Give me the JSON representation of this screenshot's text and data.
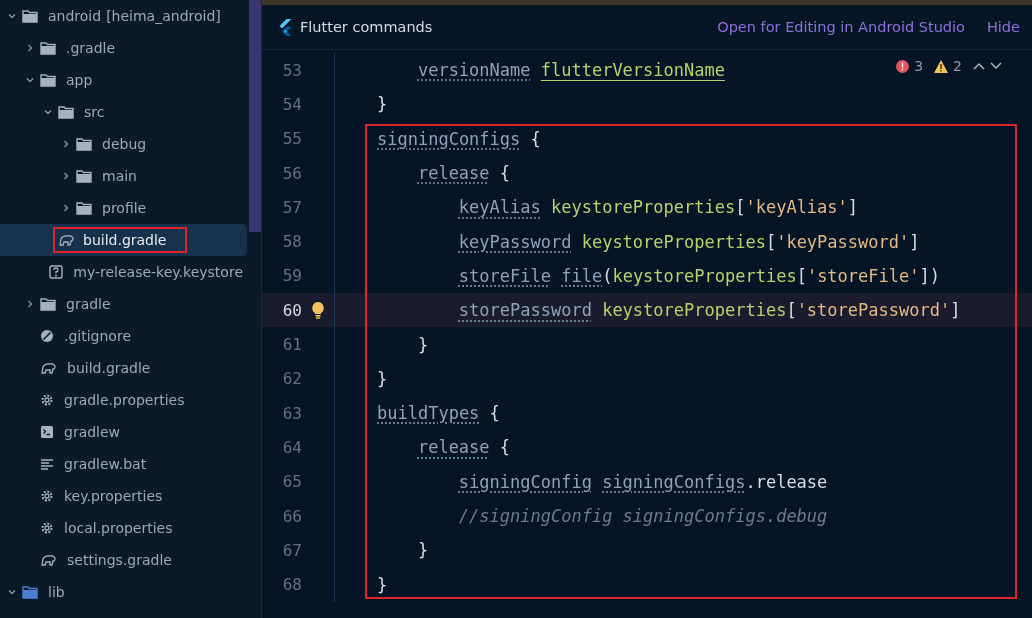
{
  "project_tree": [
    {
      "label": "android",
      "suffix": "[heima_android]",
      "kind": "folder",
      "expanded": true,
      "selected": false,
      "children": [
        {
          "label": ".gradle",
          "kind": "folder",
          "expanded": false,
          "selected": false
        },
        {
          "label": "app",
          "kind": "folder",
          "expanded": true,
          "selected": false,
          "children": [
            {
              "label": "src",
              "kind": "folder",
              "expanded": true,
              "selected": false,
              "children": [
                {
                  "label": "debug",
                  "kind": "folder",
                  "expanded": false,
                  "selected": false
                },
                {
                  "label": "main",
                  "kind": "folder",
                  "expanded": false,
                  "selected": false
                },
                {
                  "label": "profile",
                  "kind": "folder",
                  "expanded": false,
                  "selected": false
                }
              ]
            },
            {
              "label": "build.gradle",
              "kind": "gradle",
              "selected": true
            },
            {
              "label": "my-release-key.keystore",
              "kind": "unknown",
              "selected": false
            }
          ]
        },
        {
          "label": "gradle",
          "kind": "folder",
          "expanded": false,
          "selected": false
        },
        {
          "label": ".gitignore",
          "kind": "ignore",
          "selected": false
        },
        {
          "label": "build.gradle",
          "kind": "gradle",
          "selected": false
        },
        {
          "label": "gradle.properties",
          "kind": "settings",
          "selected": false
        },
        {
          "label": "gradlew",
          "kind": "terminal",
          "selected": false
        },
        {
          "label": "gradlew.bat",
          "kind": "text",
          "selected": false
        },
        {
          "label": "key.properties",
          "kind": "settings",
          "selected": false
        },
        {
          "label": "local.properties",
          "kind": "settings",
          "selected": false
        },
        {
          "label": "settings.gradle",
          "kind": "gradle",
          "selected": false
        }
      ]
    },
    {
      "label": "lib",
      "kind": "source-folder",
      "expanded": true,
      "selected": false
    }
  ],
  "banner": {
    "title": "Flutter commands",
    "actions": [
      "Open for Editing in Android Studio",
      "Hide"
    ]
  },
  "inspections": {
    "errors": "3",
    "warnings": "2"
  },
  "code_lines": [
    {
      "children": [
        {
          "number": "53",
          "current": false,
          "tokens": [
            {
              "kind": "prop",
              "text": "versionName"
            },
            {
              "kind": "ident-underlined",
              "space": true,
              "text": "flutterVersionName"
            }
          ]
        }
      ]
    },
    {
      "number": "54",
      "current": false,
      "tokens": [
        {
          "kind": "plain",
          "text": "}"
        }
      ]
    },
    {
      "number": "55",
      "current": false,
      "tokens": [
        {
          "kind": "prop",
          "text": "signingConfigs"
        },
        {
          "kind": "plain",
          "space": true,
          "text": "{"
        }
      ],
      "children": [
        {
          "number": "56",
          "current": false,
          "tokens": [
            {
              "kind": "prop",
              "text": "release"
            },
            {
              "kind": "plain",
              "space": true,
              "text": "{"
            }
          ],
          "children": [
            {
              "number": "57",
              "current": false,
              "tokens": [
                {
                  "kind": "prop",
                  "text": "keyAlias"
                },
                {
                  "kind": "ident",
                  "space": true,
                  "text": "keystoreProperties"
                },
                {
                  "kind": "plain",
                  "text": "["
                },
                {
                  "kind": "string",
                  "text": "'keyAlias'"
                },
                {
                  "kind": "plain",
                  "text": "]"
                }
              ]
            },
            {
              "number": "58",
              "current": false,
              "tokens": [
                {
                  "kind": "prop",
                  "text": "keyPassword"
                },
                {
                  "kind": "ident",
                  "space": true,
                  "text": "keystoreProperties"
                },
                {
                  "kind": "plain",
                  "text": "["
                },
                {
                  "kind": "string",
                  "text": "'keyPassword'"
                },
                {
                  "kind": "plain",
                  "text": "]"
                }
              ]
            },
            {
              "number": "59",
              "current": false,
              "tokens": [
                {
                  "kind": "prop",
                  "text": "storeFile"
                },
                {
                  "kind": "prop",
                  "space": true,
                  "text": "file"
                },
                {
                  "kind": "plain",
                  "text": "("
                },
                {
                  "kind": "ident",
                  "text": "keystoreProperties"
                },
                {
                  "kind": "plain",
                  "text": "["
                },
                {
                  "kind": "string",
                  "text": "'storeFile'"
                },
                {
                  "kind": "plain",
                  "text": "])"
                }
              ]
            },
            {
              "number": "60",
              "current": true,
              "tokens": [
                {
                  "kind": "prop",
                  "text": "storePassword"
                },
                {
                  "kind": "ident",
                  "space": true,
                  "text": "keystoreProperties"
                },
                {
                  "kind": "plain",
                  "text": "["
                },
                {
                  "kind": "string",
                  "text": "'storePassword'"
                },
                {
                  "kind": "plain",
                  "text": "]"
                }
              ]
            }
          ]
        },
        {
          "number": "61",
          "current": false,
          "tokens": [
            {
              "kind": "plain",
              "text": "}"
            }
          ]
        }
      ]
    },
    {
      "number": "62",
      "current": false,
      "tokens": [
        {
          "kind": "plain",
          "text": "}"
        }
      ]
    },
    {
      "number": "63",
      "current": false,
      "tokens": [
        {
          "kind": "prop",
          "text": "buildTypes"
        },
        {
          "kind": "plain",
          "space": true,
          "text": "{"
        }
      ],
      "children": [
        {
          "number": "64",
          "current": false,
          "tokens": [
            {
              "kind": "prop",
              "text": "release"
            },
            {
              "kind": "plain",
              "space": true,
              "text": "{"
            }
          ],
          "children": [
            {
              "number": "65",
              "current": false,
              "tokens": [
                {
                  "kind": "prop",
                  "text": "signingConfig"
                },
                {
                  "kind": "prop",
                  "space": true,
                  "text": "signingConfigs"
                },
                {
                  "kind": "plain",
                  "text": ".release"
                }
              ]
            },
            {
              "number": "66",
              "current": false,
              "tokens": [
                {
                  "kind": "comment",
                  "text": "//signingConfig signingConfigs.debug"
                }
              ]
            }
          ]
        },
        {
          "number": "67",
          "current": false,
          "tokens": [
            {
              "kind": "plain",
              "text": "}"
            }
          ]
        }
      ]
    },
    {
      "number": "68",
      "current": false,
      "tokens": [
        {
          "kind": "plain",
          "text": "}"
        }
      ]
    }
  ]
}
